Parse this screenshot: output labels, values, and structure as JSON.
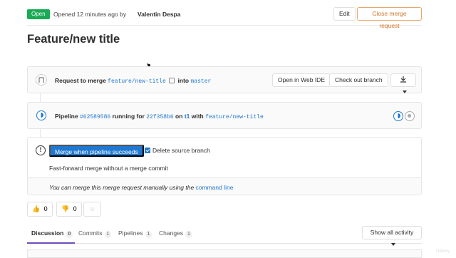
{
  "header": {
    "status_badge": "Open",
    "opened_text": "Opened 12 minutes ago by",
    "author": "Valentin Despa",
    "edit_label": "Edit",
    "close_label": "Close merge request"
  },
  "title": "Feature/new title",
  "request": {
    "prefix": "Request to merge",
    "source_branch": "feature/new-title",
    "into": "into",
    "target_branch": "master",
    "open_ide_label": "Open in Web IDE",
    "checkout_label": "Check out branch"
  },
  "pipeline": {
    "prefix": "Pipeline",
    "id": "#62589586",
    "status_text": "running for",
    "commit": "22f358b6",
    "on": "on",
    "project": "t1",
    "with": "with",
    "branch": "feature/new-title"
  },
  "merge": {
    "merge_button_label": "Merge when pipeline succeeds",
    "delete_source_label": "Delete source branch",
    "delete_source_checked": true,
    "ff_text": "Fast-forward merge without a merge commit",
    "manual_text": "You can merge this merge request manually using the",
    "command_line_link": "command line"
  },
  "awards": {
    "thumbs_up_count": "0",
    "thumbs_down_count": "0"
  },
  "tabs": [
    {
      "label": "Discussion",
      "count": "0"
    },
    {
      "label": "Commits",
      "count": "1"
    },
    {
      "label": "Pipelines",
      "count": "1"
    },
    {
      "label": "Changes",
      "count": "1"
    }
  ],
  "activity_filter": "Show all activity",
  "colors": {
    "open_badge": "#1aaa55",
    "primary": "#1f78d1",
    "close_button": "#d7762a",
    "active_tab": "#6b4fbb"
  },
  "watermark": "Udemy"
}
